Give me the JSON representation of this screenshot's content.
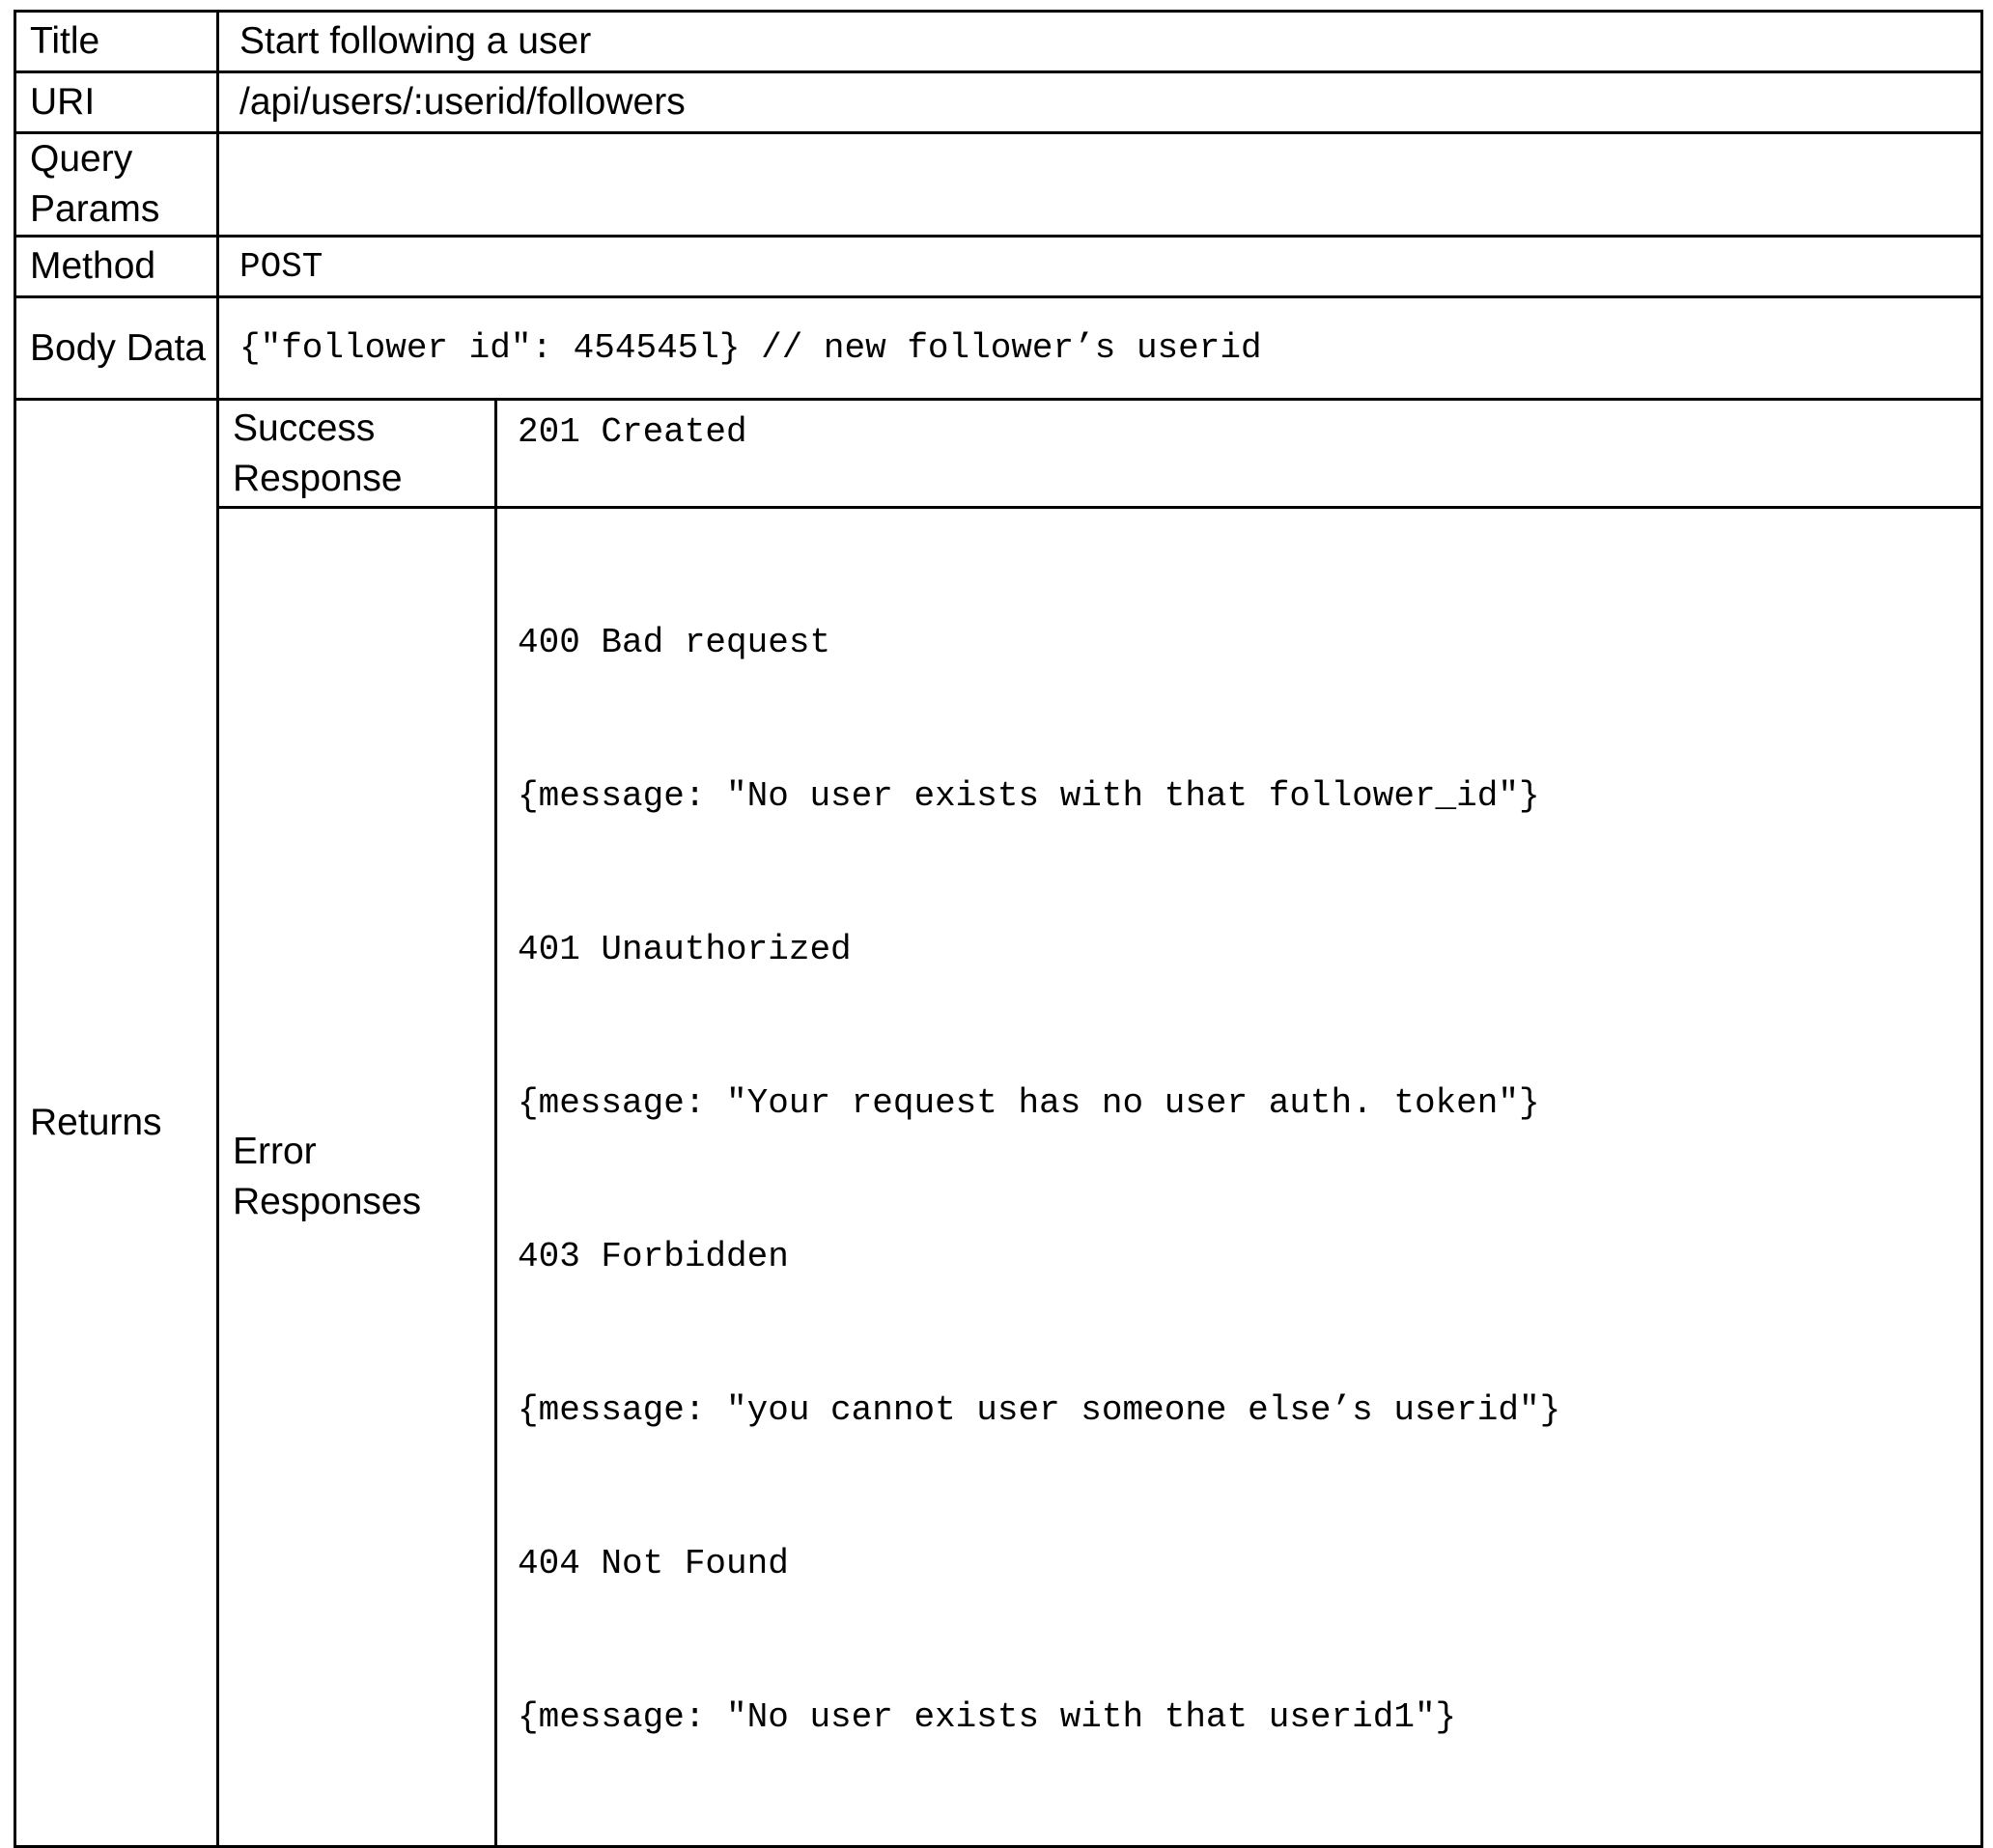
{
  "labels": {
    "title": "Title",
    "uri": "URI",
    "query_params": "Query Params",
    "method": "Method",
    "body_data": "Body Data",
    "returns": "Returns",
    "success_response": "Success Response",
    "error_responses": "Error Responses"
  },
  "values": {
    "title": "Start following a user",
    "uri": "/api/users/:userid/followers",
    "query_params": "",
    "method": "POST",
    "body_data": "{\"follower id\": 454545l} // new follower’s userid",
    "success_response": "201 Created",
    "error_responses": [
      "400 Bad request",
      "{message: \"No user exists with that follower_id\"}",
      "401 Unauthorized",
      "{message: \"Your request has no user auth. token\"}",
      "403 Forbidden",
      "{message: \"you cannot user someone else’s userid\"}",
      "404 Not Found",
      "{message: \"No user exists with that userid1\"}"
    ]
  }
}
